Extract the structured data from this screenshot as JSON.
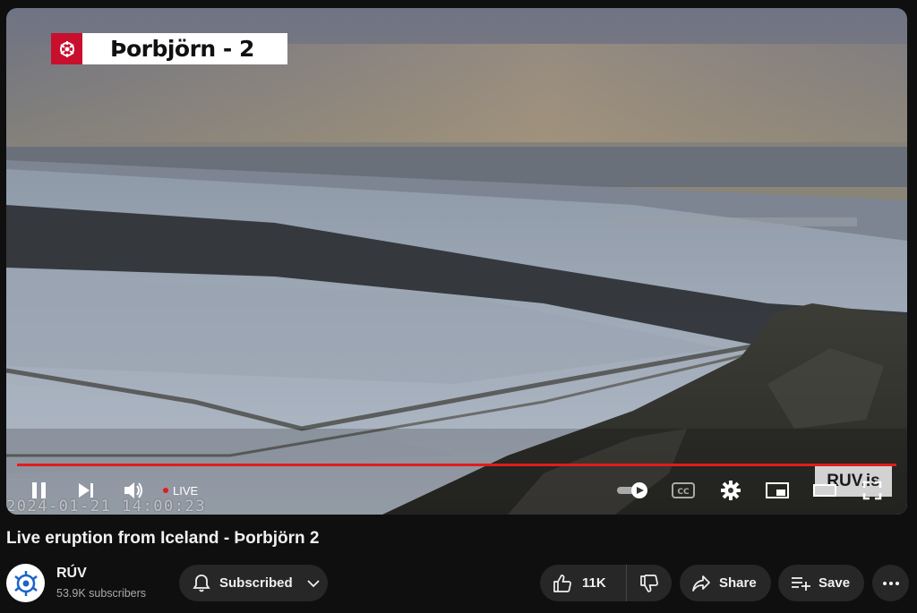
{
  "player": {
    "overlay_title": "Þorbjörn - 2",
    "overlay_logo_icon": "ruv-crest-icon",
    "timestamp": "2024-01-21 14:00:23",
    "watermark": "RUV.is",
    "progress_fraction": 1.0,
    "accent_color": "#e21c1c",
    "controls": {
      "pause_icon": "pause-icon",
      "next_icon": "next-icon",
      "volume_icon": "volume-icon",
      "live_label": "LIVE",
      "autoplay_icon": "autoplay-toggle-icon",
      "captions_icon": "cc-icon",
      "settings_icon": "gear-icon",
      "miniplayer_icon": "miniplayer-icon",
      "theater_icon": "theater-icon",
      "fullscreen_icon": "fullscreen-icon"
    }
  },
  "video": {
    "title": "Live eruption from Iceland - Þorbjörn 2"
  },
  "channel": {
    "name": "RÚV",
    "subscribers": "53.9K subscribers",
    "subscribe_label": "Subscribed"
  },
  "actions": {
    "like_count": "11K",
    "share_label": "Share",
    "save_label": "Save"
  }
}
